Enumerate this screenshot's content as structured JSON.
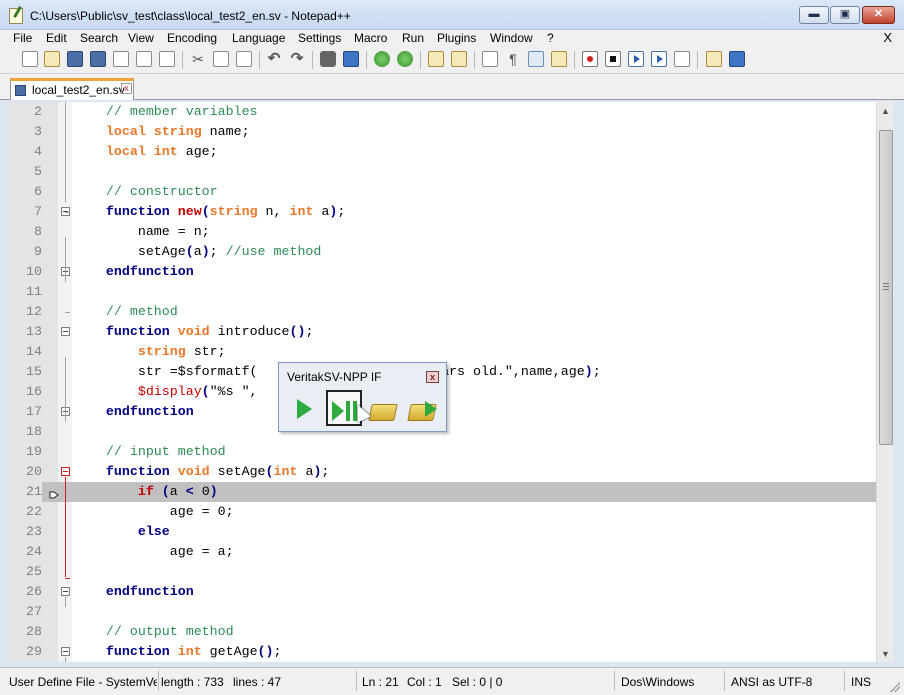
{
  "window": {
    "title": "C:\\Users\\Public\\sv_test\\class\\local_test2_en.sv - Notepad++",
    "min_label": "▬",
    "max_label": "▣",
    "close_label": "✕"
  },
  "menu": [
    "File",
    "Edit",
    "Search",
    "View",
    "Encoding",
    "Language",
    "Settings",
    "Macro",
    "Run",
    "Plugins",
    "Window",
    "?"
  ],
  "menu_close": "X",
  "tab": {
    "label": "local_test2_en.sv",
    "close": "x"
  },
  "editor": {
    "current_line": 21,
    "lines": [
      {
        "n": "2",
        "code": [
          [
            "cm",
            "    // member variables"
          ]
        ]
      },
      {
        "n": "3",
        "code": [
          [
            "kw",
            "    local string"
          ],
          [
            "plain",
            " name;"
          ]
        ]
      },
      {
        "n": "4",
        "code": [
          [
            "kw",
            "    local int"
          ],
          [
            "plain",
            " age;"
          ]
        ]
      },
      {
        "n": "5",
        "code": [
          [
            "plain",
            ""
          ]
        ]
      },
      {
        "n": "6",
        "code": [
          [
            "cm",
            "    // constructor"
          ]
        ]
      },
      {
        "n": "7",
        "code": [
          [
            "kwb",
            "    function"
          ],
          [
            "kwr",
            " new"
          ],
          [
            "op",
            "("
          ],
          [
            "kw",
            "string"
          ],
          [
            "plain",
            " n, "
          ],
          [
            "kw",
            "int"
          ],
          [
            "plain",
            " a"
          ],
          [
            "op",
            ")"
          ],
          [
            "plain",
            ";"
          ]
        ]
      },
      {
        "n": "8",
        "code": [
          [
            "plain",
            "        name = n;"
          ]
        ]
      },
      {
        "n": "9",
        "code": [
          [
            "plain",
            "        setAge"
          ],
          [
            "op",
            "("
          ],
          [
            "plain",
            "a"
          ],
          [
            "op",
            ")"
          ],
          [
            "plain",
            "; "
          ],
          [
            "cm",
            "//use method"
          ]
        ]
      },
      {
        "n": "10",
        "code": [
          [
            "kwb",
            "    endfunction"
          ]
        ]
      },
      {
        "n": "11",
        "code": [
          [
            "plain",
            ""
          ]
        ]
      },
      {
        "n": "12",
        "code": [
          [
            "cm",
            "    // method"
          ]
        ]
      },
      {
        "n": "13",
        "code": [
          [
            "kwb",
            "    function"
          ],
          [
            "kw",
            " void"
          ],
          [
            "plain",
            " introduce"
          ],
          [
            "op",
            "()"
          ],
          [
            "plain",
            ";"
          ]
        ]
      },
      {
        "n": "14",
        "code": [
          [
            "kw",
            "        string"
          ],
          [
            "plain",
            " str;"
          ]
        ]
      },
      {
        "n": "15",
        "code": [
          [
            "plain",
            "        str =$sformatf("
          ],
          [
            "plain",
            "                  "
          ],
          [
            "plain",
            "%2dyears old.\",name,age"
          ],
          [
            "op",
            ")"
          ],
          [
            "plain",
            ";"
          ]
        ]
      },
      {
        "n": "16",
        "code": [
          [
            "sys",
            "        $display"
          ],
          [
            "op",
            "("
          ],
          [
            "plain",
            "\"%s \","
          ]
        ]
      },
      {
        "n": "17",
        "code": [
          [
            "kwb",
            "    endfunction"
          ]
        ]
      },
      {
        "n": "18",
        "code": [
          [
            "plain",
            ""
          ]
        ]
      },
      {
        "n": "19",
        "code": [
          [
            "cm",
            "    // input method"
          ]
        ]
      },
      {
        "n": "20",
        "code": [
          [
            "kwb",
            "    function"
          ],
          [
            "kw",
            " void"
          ],
          [
            "plain",
            " setAge"
          ],
          [
            "op",
            "("
          ],
          [
            "kw",
            "int"
          ],
          [
            "plain",
            " a"
          ],
          [
            "op",
            ")"
          ],
          [
            "plain",
            ";"
          ]
        ]
      },
      {
        "n": "21",
        "code": [
          [
            "kwr",
            "        if"
          ],
          [
            "plain",
            " "
          ],
          [
            "op",
            "("
          ],
          [
            "plain",
            "a "
          ],
          [
            "op",
            "<"
          ],
          [
            "plain",
            " 0"
          ],
          [
            "op",
            ")"
          ]
        ]
      },
      {
        "n": "22",
        "code": [
          [
            "plain",
            "            age = 0;"
          ]
        ]
      },
      {
        "n": "23",
        "code": [
          [
            "kwb",
            "        else"
          ]
        ]
      },
      {
        "n": "24",
        "code": [
          [
            "plain",
            "            age = a;"
          ]
        ]
      },
      {
        "n": "25",
        "code": [
          [
            "plain",
            ""
          ]
        ]
      },
      {
        "n": "26",
        "code": [
          [
            "kwb",
            "    endfunction"
          ]
        ]
      },
      {
        "n": "27",
        "code": [
          [
            "plain",
            ""
          ]
        ]
      },
      {
        "n": "28",
        "code": [
          [
            "cm",
            "    // output method"
          ]
        ]
      },
      {
        "n": "29",
        "code": [
          [
            "kwb",
            "    function"
          ],
          [
            "kw",
            " int"
          ],
          [
            "plain",
            " getAge"
          ],
          [
            "op",
            "()"
          ],
          [
            "plain",
            ";"
          ]
        ]
      }
    ]
  },
  "popup": {
    "title": "VeritakSV-NPP IF",
    "close": "x"
  },
  "status": {
    "file_type": "User Define File - SystemVer",
    "length": "length : 733",
    "lines": "lines : 47",
    "ln": "Ln : 21",
    "col": "Col : 1",
    "sel": "Sel : 0 | 0",
    "eol": "Dos\\Windows",
    "encoding": "ANSI as UTF-8",
    "mode": "INS"
  }
}
